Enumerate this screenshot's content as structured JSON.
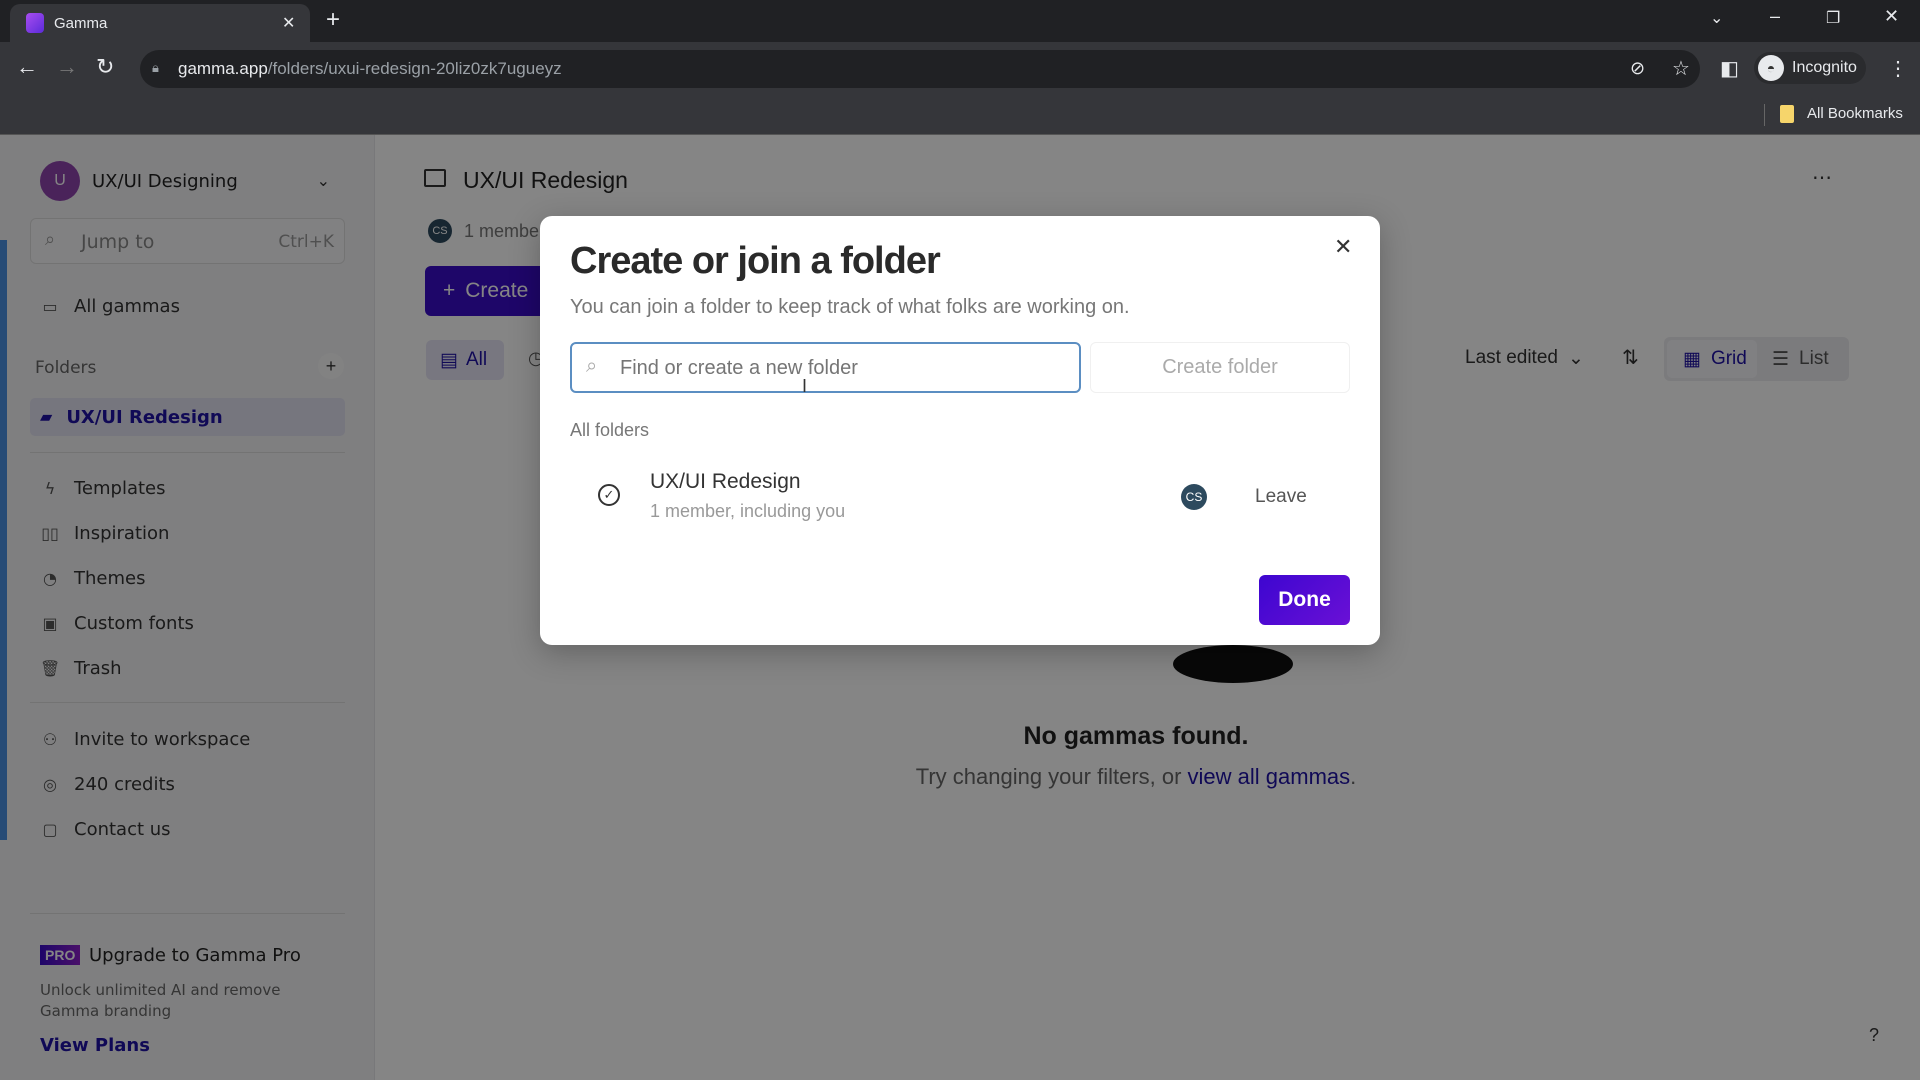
{
  "browser": {
    "tab_title": "Gamma",
    "url_host": "gamma.app",
    "url_path": "/folders/uxui-redesign-20liz0zk7ugueyz",
    "profile": "Incognito",
    "bookmarks": "All Bookmarks"
  },
  "sidebar": {
    "workspace_initial": "U",
    "workspace_name": "UX/UI Designing",
    "jump_placeholder": "Jump to",
    "jump_shortcut": "Ctrl+K",
    "all_gammas": "All gammas",
    "folders_label": "Folders",
    "active_folder": "UX/UI Redesign",
    "items": [
      {
        "label": "Templates",
        "icon": "templates-icon"
      },
      {
        "label": "Inspiration",
        "icon": "book-icon"
      },
      {
        "label": "Themes",
        "icon": "palette-icon"
      },
      {
        "label": "Custom fonts",
        "icon": "font-icon"
      },
      {
        "label": "Trash",
        "icon": "trash-icon"
      }
    ],
    "secondary": [
      {
        "label": "Invite to workspace",
        "icon": "invite-user-icon"
      },
      {
        "label": "240 credits",
        "icon": "credits-icon"
      },
      {
        "label": "Contact us",
        "icon": "chat-icon"
      }
    ],
    "pro_badge": "PRO",
    "upgrade_title": "Upgrade to Gamma Pro",
    "upgrade_desc": "Unlock unlimited AI and remove Gamma branding",
    "view_plans": "View Plans"
  },
  "main": {
    "folder_title": "UX/UI Redesign",
    "member_avatar": "CS",
    "member_text": "1 member",
    "create_label": "Create",
    "filter_all": "All",
    "sort_label": "Last edited",
    "view_grid": "Grid",
    "view_list": "List",
    "empty_title": "No gammas found.",
    "empty_text": "Try changing your filters, or ",
    "empty_link": "view all gammas",
    "empty_end": "."
  },
  "modal": {
    "title": "Create or join a folder",
    "subtitle": "You can join a folder to keep track of what folks are working on.",
    "search_placeholder": "Find or create a new folder",
    "search_value": "",
    "create_button": "Create folder",
    "section_label": "All folders",
    "folders": [
      {
        "name": "UX/UI Redesign",
        "members": "1 member, including you",
        "avatar": "CS",
        "action": "Leave",
        "joined": true
      }
    ],
    "done_button": "Done"
  },
  "colors": {
    "accent": "#3b0cc9",
    "active_text": "#1f12a6",
    "avatar_ws": "#8e44ad",
    "avatar_cs": "#2d4a5e"
  }
}
